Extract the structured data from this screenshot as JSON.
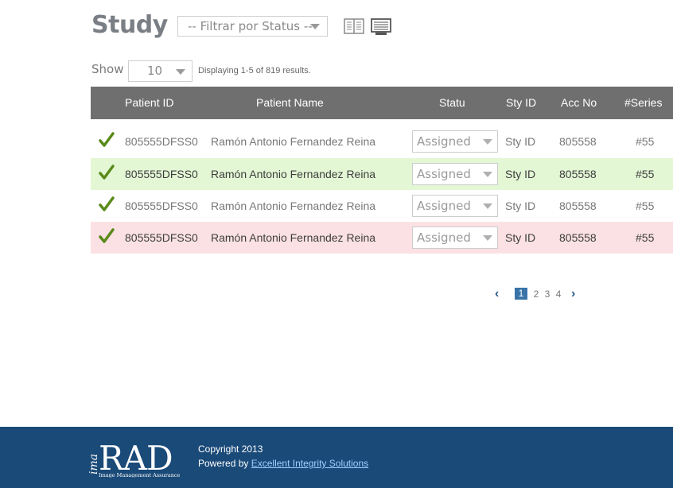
{
  "header": {
    "title": "Study",
    "filter_placeholder": "-- Filtrar por Status  --",
    "view_icons": [
      "detail-view-icon",
      "list-view-icon"
    ]
  },
  "controls": {
    "show_label": "Show",
    "page_size": "10",
    "results_info": "Displaying 1-5 of 819 results."
  },
  "table": {
    "columns": [
      "Patient ID",
      "Patient Name",
      "Statu",
      "Sty ID",
      "Acc No",
      "#Series"
    ],
    "rows": [
      {
        "patient_id": "805555DFSS0",
        "patient_name": "Ramón Antonio Fernandez Reina",
        "status": "Assigned",
        "sty_id": "Sty ID",
        "acc_no": "805558",
        "series": "#55",
        "highlight": "none"
      },
      {
        "patient_id": "805555DFSS0",
        "patient_name": "Ramón Antonio Fernandez Reina",
        "status": "Assigned",
        "sty_id": "Sty ID",
        "acc_no": "805558",
        "series": "#55",
        "highlight": "green"
      },
      {
        "patient_id": "805555DFSS0",
        "patient_name": "Ramón Antonio Fernandez Reina",
        "status": "Assigned",
        "sty_id": "Sty ID",
        "acc_no": "805558",
        "series": "#55",
        "highlight": "none"
      },
      {
        "patient_id": "805555DFSS0",
        "patient_name": "Ramón Antonio Fernandez Reina",
        "status": "Assigned",
        "sty_id": "Sty ID",
        "acc_no": "805558",
        "series": "#55",
        "highlight": "pink"
      }
    ]
  },
  "pagination": {
    "pages": [
      "1",
      "2",
      "3",
      "4"
    ],
    "current": "1"
  },
  "footer": {
    "logo_text": "imaRAD",
    "logo_tagline": "Image Management Assurance",
    "copyright": "Copyright 2013",
    "powered_by": "Powered by",
    "company": "Excellent Integrity Solutions"
  },
  "colors": {
    "header_bg": "#6f6f6f",
    "footer_bg": "#1a4a78",
    "check": "#5a8a1a",
    "row_green": "#e3f7d5",
    "row_pink": "#fbe1e3",
    "accent": "#3a73a8"
  }
}
